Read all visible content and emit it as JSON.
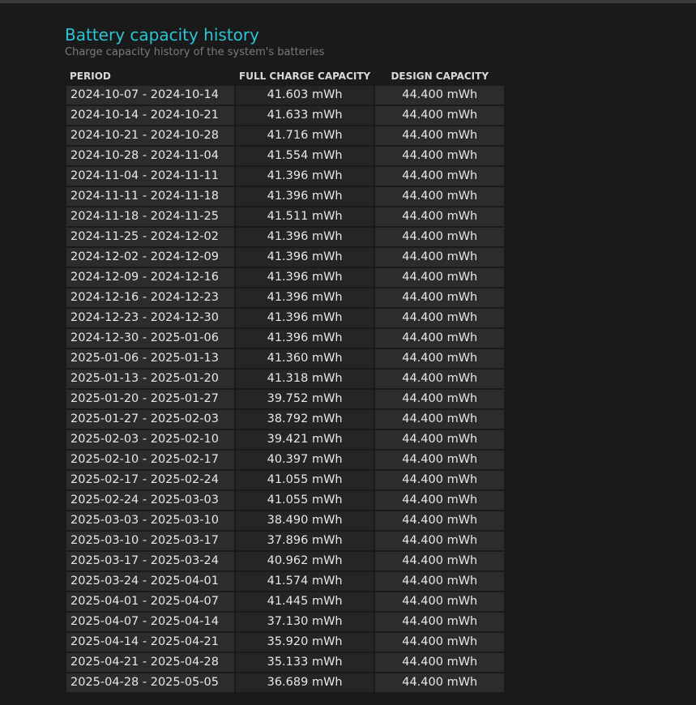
{
  "section": {
    "title": "Battery capacity history",
    "subtitle": "Charge capacity history of the system's batteries"
  },
  "table": {
    "headers": [
      "PERIOD",
      "FULL CHARGE CAPACITY",
      "DESIGN CAPACITY"
    ],
    "rows": [
      [
        "2024-10-07 - 2024-10-14",
        "41.603 mWh",
        "44.400 mWh"
      ],
      [
        "2024-10-14 - 2024-10-21",
        "41.633 mWh",
        "44.400 mWh"
      ],
      [
        "2024-10-21 - 2024-10-28",
        "41.716 mWh",
        "44.400 mWh"
      ],
      [
        "2024-10-28 - 2024-11-04",
        "41.554 mWh",
        "44.400 mWh"
      ],
      [
        "2024-11-04 - 2024-11-11",
        "41.396 mWh",
        "44.400 mWh"
      ],
      [
        "2024-11-11 - 2024-11-18",
        "41.396 mWh",
        "44.400 mWh"
      ],
      [
        "2024-11-18 - 2024-11-25",
        "41.511 mWh",
        "44.400 mWh"
      ],
      [
        "2024-11-25 - 2024-12-02",
        "41.396 mWh",
        "44.400 mWh"
      ],
      [
        "2024-12-02 - 2024-12-09",
        "41.396 mWh",
        "44.400 mWh"
      ],
      [
        "2024-12-09 - 2024-12-16",
        "41.396 mWh",
        "44.400 mWh"
      ],
      [
        "2024-12-16 - 2024-12-23",
        "41.396 mWh",
        "44.400 mWh"
      ],
      [
        "2024-12-23 - 2024-12-30",
        "41.396 mWh",
        "44.400 mWh"
      ],
      [
        "2024-12-30 - 2025-01-06",
        "41.396 mWh",
        "44.400 mWh"
      ],
      [
        "2025-01-06 - 2025-01-13",
        "41.360 mWh",
        "44.400 mWh"
      ],
      [
        "2025-01-13 - 2025-01-20",
        "41.318 mWh",
        "44.400 mWh"
      ],
      [
        "2025-01-20 - 2025-01-27",
        "39.752 mWh",
        "44.400 mWh"
      ],
      [
        "2025-01-27 - 2025-02-03",
        "38.792 mWh",
        "44.400 mWh"
      ],
      [
        "2025-02-03 - 2025-02-10",
        "39.421 mWh",
        "44.400 mWh"
      ],
      [
        "2025-02-10 - 2025-02-17",
        "40.397 mWh",
        "44.400 mWh"
      ],
      [
        "2025-02-17 - 2025-02-24",
        "41.055 mWh",
        "44.400 mWh"
      ],
      [
        "2025-02-24 - 2025-03-03",
        "41.055 mWh",
        "44.400 mWh"
      ],
      [
        "2025-03-03 - 2025-03-10",
        "38.490 mWh",
        "44.400 mWh"
      ],
      [
        "2025-03-10 - 2025-03-17",
        "37.896 mWh",
        "44.400 mWh"
      ],
      [
        "2025-03-17 - 2025-03-24",
        "40.962 mWh",
        "44.400 mWh"
      ],
      [
        "2025-03-24 - 2025-04-01",
        "41.574 mWh",
        "44.400 mWh"
      ],
      [
        "2025-04-01 - 2025-04-07",
        "41.445 mWh",
        "44.400 mWh"
      ],
      [
        "2025-04-07 - 2025-04-14",
        "37.130 mWh",
        "44.400 mWh"
      ],
      [
        "2025-04-14 - 2025-04-21",
        "35.920 mWh",
        "44.400 mWh"
      ],
      [
        "2025-04-21 - 2025-04-28",
        "35.133 mWh",
        "44.400 mWh"
      ],
      [
        "2025-04-28 - 2025-05-05",
        "36.689 mWh",
        "44.400 mWh"
      ]
    ]
  }
}
